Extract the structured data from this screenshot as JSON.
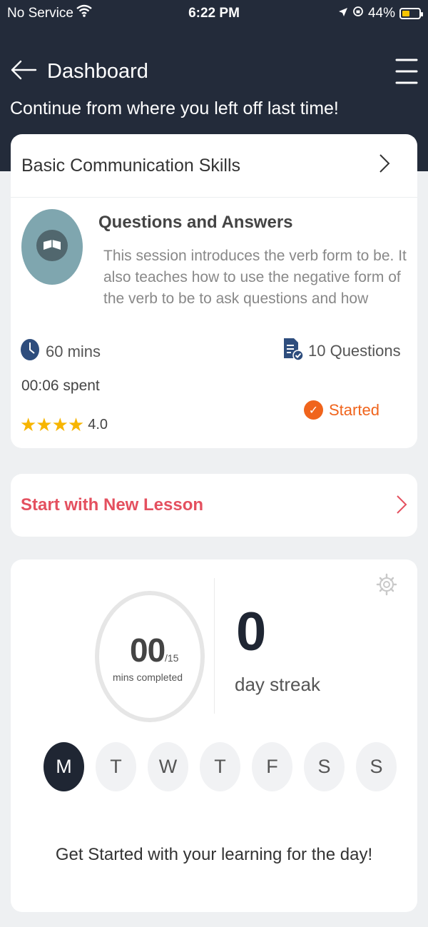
{
  "status_bar": {
    "carrier": "No Service",
    "time": "6:22 PM",
    "battery": "44%",
    "icons": [
      "wifi-icon",
      "location-arrow-icon",
      "orientation-lock-icon",
      "battery-icon"
    ]
  },
  "header": {
    "title": "Dashboard",
    "subtitle": "Continue from where you left off last time!"
  },
  "current_lesson": {
    "course_title": "Basic Communication Skills",
    "lesson_title": "Questions and Answers",
    "description": "This session introduces the verb form to be. It also teaches how to use the negative form of the verb to be to ask questions and how",
    "duration": "60 mins",
    "questions": "10 Questions",
    "time_spent": "00:06 spent",
    "rating": "4.0",
    "stars": "★★★★",
    "status": "Started",
    "status_color": "#f0641c"
  },
  "new_lesson": {
    "label": "Start with New Lesson",
    "color": "#e4505f"
  },
  "progress": {
    "minutes_completed": "00",
    "minutes_goal": "/15",
    "minutes_label": "mins completed",
    "streak_count": "0",
    "streak_label": "day streak",
    "days": [
      {
        "label": "M",
        "active": true
      },
      {
        "label": "T",
        "active": false
      },
      {
        "label": "W",
        "active": false
      },
      {
        "label": "T",
        "active": false
      },
      {
        "label": "F",
        "active": false
      },
      {
        "label": "S",
        "active": false
      },
      {
        "label": "S",
        "active": false
      }
    ],
    "cta": "Get Started with your learning for the day!"
  },
  "colors": {
    "header_bg": "#232b3a",
    "active_day": "#1f2633",
    "star": "#f7b500"
  }
}
